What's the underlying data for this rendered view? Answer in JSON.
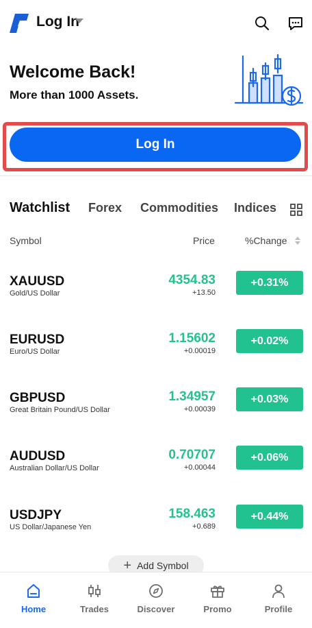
{
  "header": {
    "title": "Log In",
    "logo_icon": "brand-logo-icon",
    "search_icon": "search-icon",
    "message_icon": "message-icon"
  },
  "welcome": {
    "title": "Welcome Back!",
    "subtitle": "More than 1000 Assets.",
    "illustration_icon": "candlestick-chart-icon"
  },
  "login_button": {
    "label": "Log In"
  },
  "tabs": [
    {
      "label": "Watchlist",
      "active": true
    },
    {
      "label": "Forex",
      "active": false
    },
    {
      "label": "Commodities",
      "active": false
    },
    {
      "label": "Indices",
      "active": false
    }
  ],
  "grid_icon": "grid-icon",
  "columns": {
    "symbol": "Symbol",
    "price": "Price",
    "change": "%Change"
  },
  "rows": [
    {
      "symbol": "XAUUSD",
      "desc": "Gold/US Dollar",
      "price": "4354.83",
      "delta": "+13.50",
      "change": "+0.31%"
    },
    {
      "symbol": "EURUSD",
      "desc": "Euro/US Dollar",
      "price": "1.15602",
      "delta": "+0.00019",
      "change": "+0.02%"
    },
    {
      "symbol": "GBPUSD",
      "desc": "Great Britain Pound/US Dollar",
      "price": "1.34957",
      "delta": "+0.00039",
      "change": "+0.03%"
    },
    {
      "symbol": "AUDUSD",
      "desc": "Australian Dollar/US Dollar",
      "price": "0.70707",
      "delta": "+0.00044",
      "change": "+0.06%"
    },
    {
      "symbol": "USDJPY",
      "desc": "US Dollar/Japanese Yen",
      "price": "158.463",
      "delta": "+0.689",
      "change": "+0.44%"
    }
  ],
  "add_symbol": {
    "label": "Add Symbol"
  },
  "nav": [
    {
      "label": "Home",
      "icon": "home-icon",
      "active": true
    },
    {
      "label": "Trades",
      "icon": "trades-icon",
      "active": false
    },
    {
      "label": "Discover",
      "icon": "compass-icon",
      "active": false
    },
    {
      "label": "Promo",
      "icon": "gift-icon",
      "active": false
    },
    {
      "label": "Profile",
      "icon": "profile-icon",
      "active": false
    }
  ],
  "colors": {
    "primary": "#0a67f2",
    "positive": "#21c28f",
    "highlight_border": "#e34b4b"
  }
}
